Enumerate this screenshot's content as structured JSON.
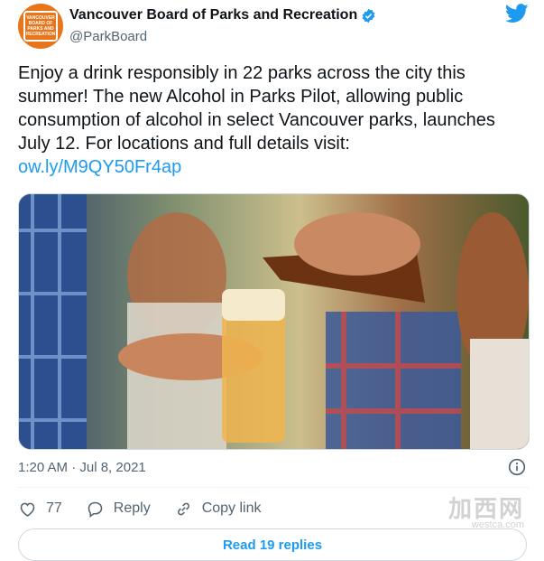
{
  "tweet": {
    "author": {
      "display_name": "Vancouver Board of Parks and Recreation",
      "handle": "@ParkBoard",
      "avatar_text": [
        "VANCOUVER",
        "BOARD OF",
        "PARKS AND",
        "RECREATION"
      ]
    },
    "text": "Enjoy a drink responsibly in 22 parks across the city this summer! The new Alcohol in Parks Pilot, allowing public consumption of alcohol in select Vancouver parks, launches July 12. For locations and full details visit:",
    "link": "ow.ly/M9QY50Fr4ap",
    "timestamp": "1:20 AM · Jul 8, 2021",
    "like_count": "77",
    "reply_label": "Reply",
    "copy_link_label": "Copy link",
    "read_replies_label": "Read 19 replies"
  },
  "watermark": {
    "main": "加西网",
    "sub": "westca.com"
  },
  "colors": {
    "brand_orange": "#e8751a",
    "twitter_blue": "#1d9bf0",
    "muted": "#536471"
  }
}
